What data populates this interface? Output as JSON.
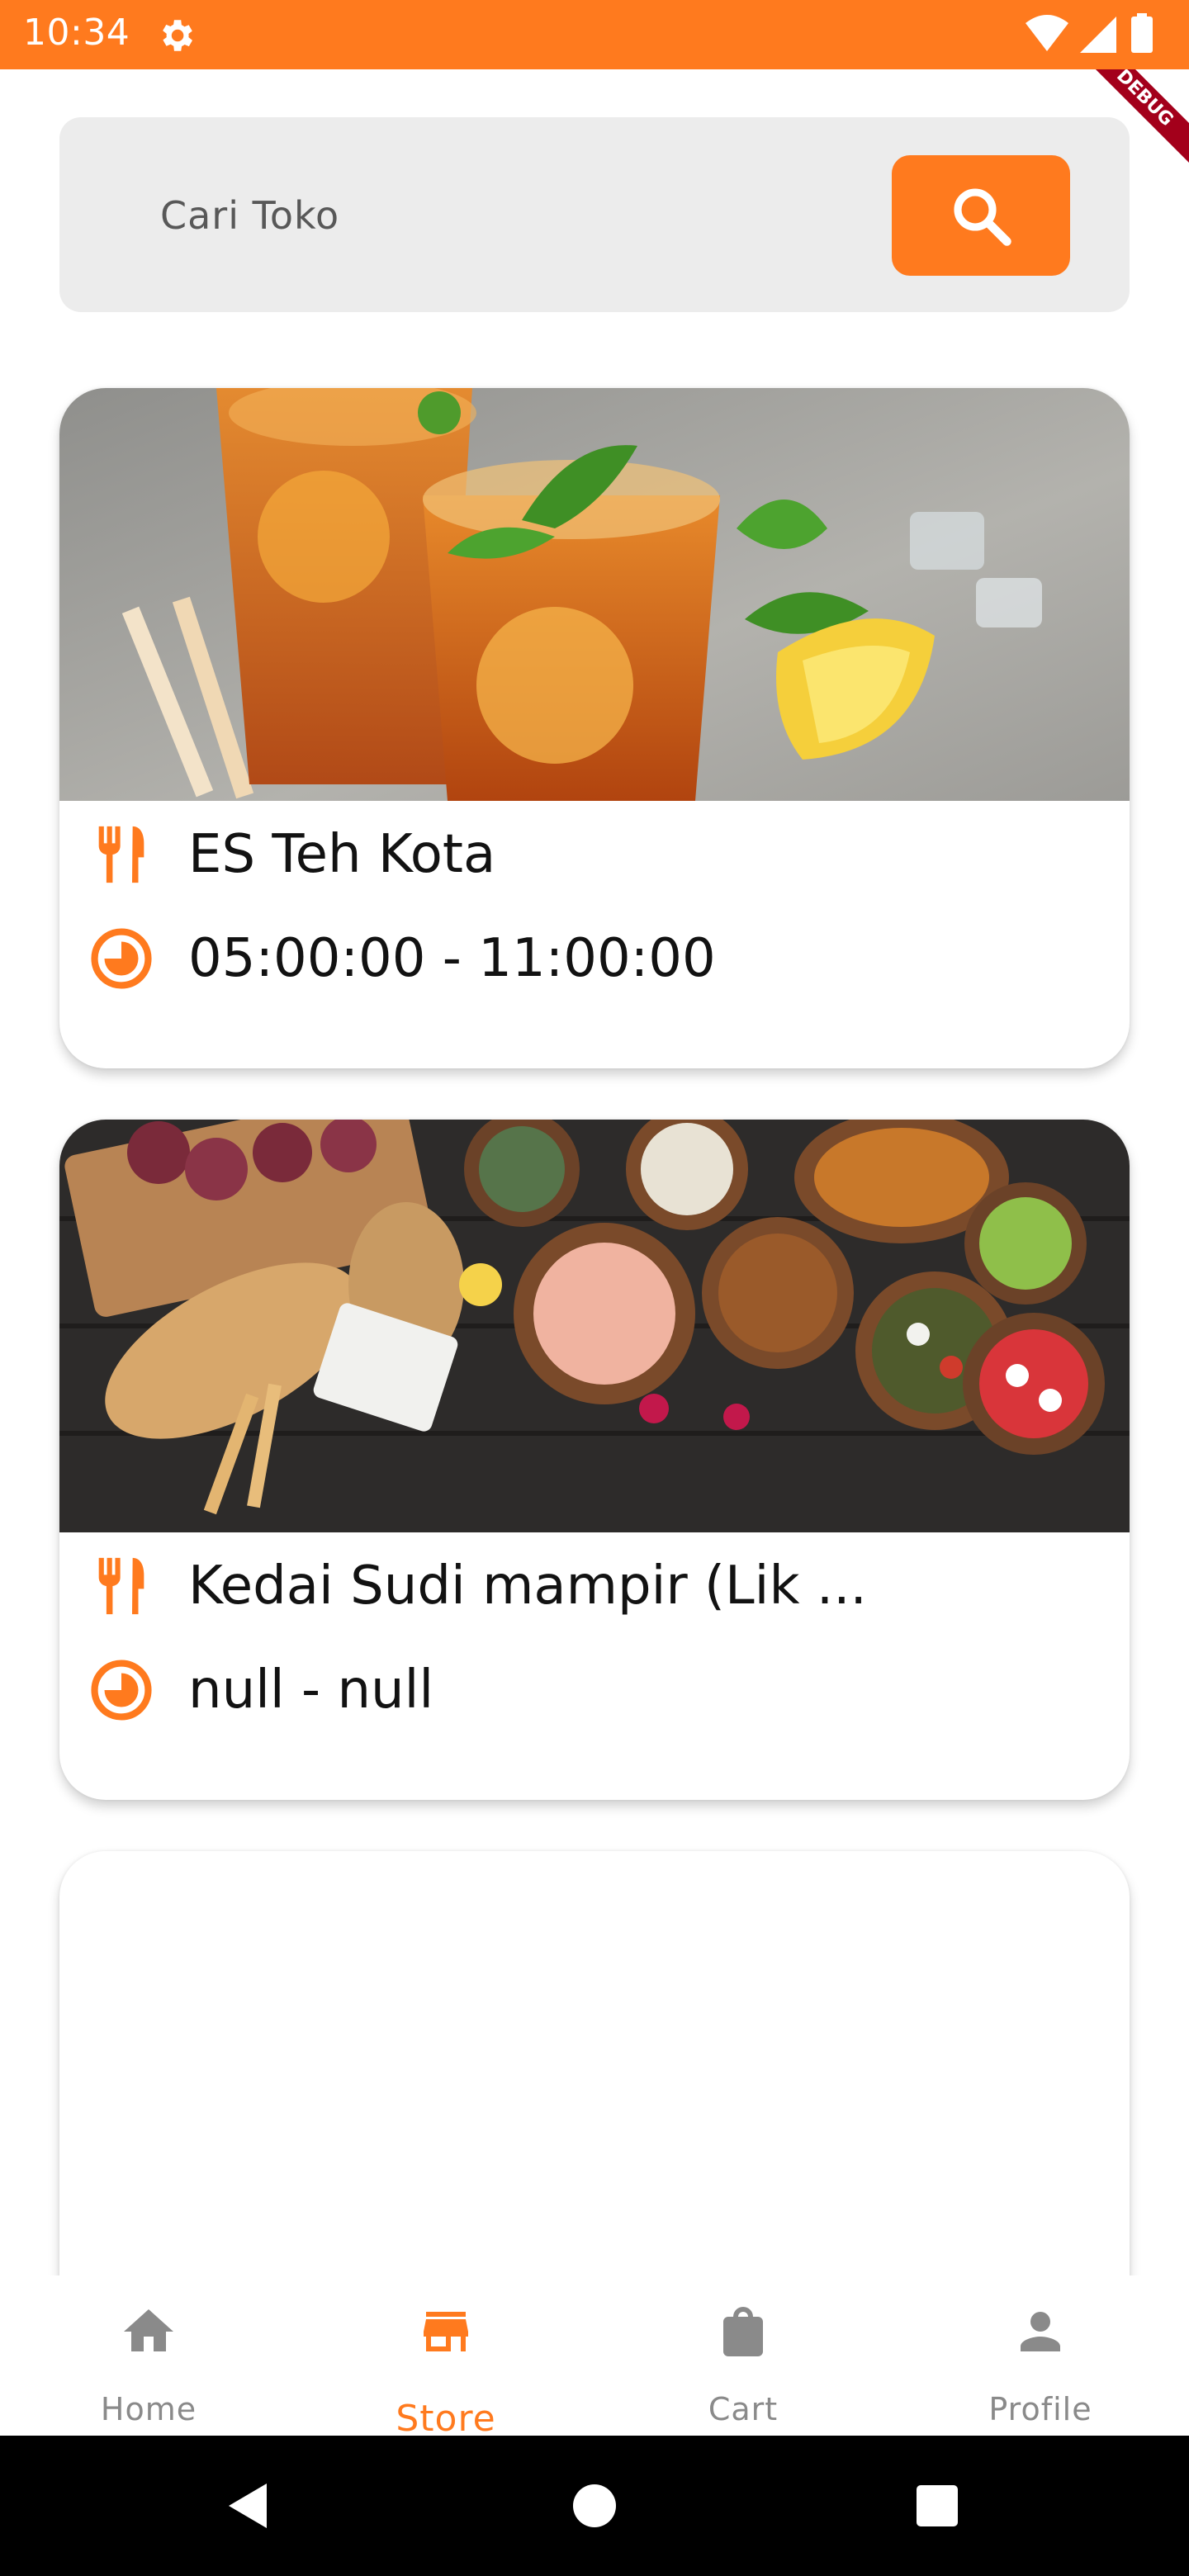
{
  "status_bar": {
    "time": "10:34"
  },
  "debug_banner": "DEBUG",
  "search": {
    "placeholder": "Cari Toko",
    "value": ""
  },
  "stores": [
    {
      "name": "ES Teh Kota",
      "hours": "05:00:00 - 11:00:00",
      "image": "iced tea glasses with lemon and mint"
    },
    {
      "name": "Kedai Sudi mampir (Lik ...",
      "hours": "null - null",
      "image": "table spread of tapas dishes"
    },
    {
      "name": "",
      "hours": "",
      "image": ""
    }
  ],
  "bottom_nav": {
    "active": "Store",
    "items": [
      {
        "label": "Home",
        "icon": "home-icon"
      },
      {
        "label": "Store",
        "icon": "store-icon"
      },
      {
        "label": "Cart",
        "icon": "shopping-bag-icon"
      },
      {
        "label": "Profile",
        "icon": "person-icon"
      }
    ]
  },
  "colors": {
    "accent": "#ff7a1e",
    "search_bg": "#ececec",
    "inactive": "#8a8a8a",
    "text": "#121212"
  }
}
